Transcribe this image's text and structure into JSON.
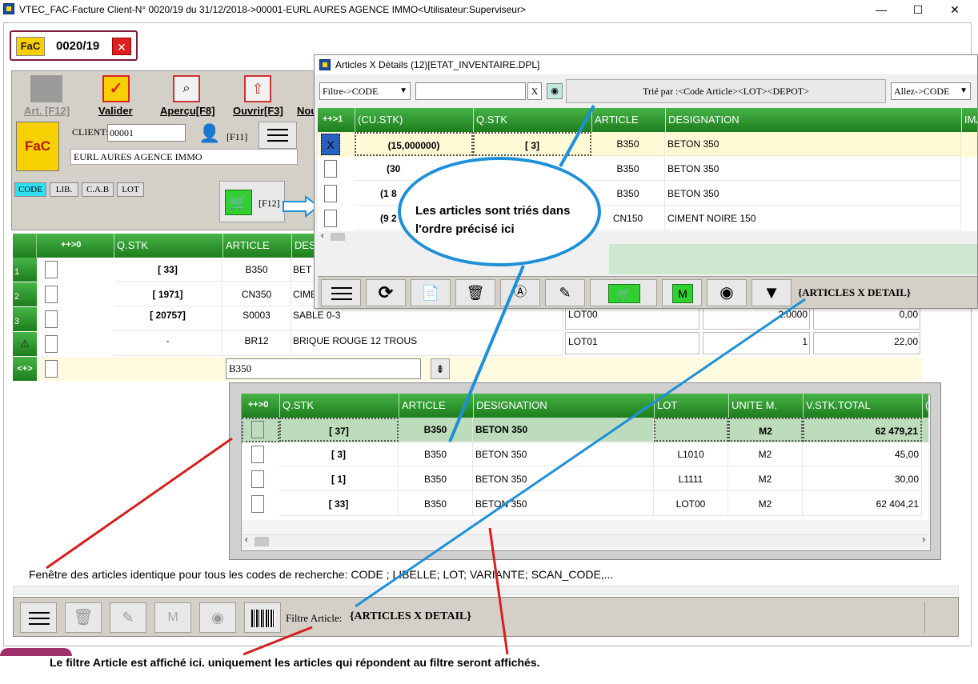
{
  "window": {
    "title": "VTEC_FAC-Facture Client-N° 0020/19 du 31/12/2018->00001-EURL AURES AGENCE IMMO<Utilisateur:Superviseur>",
    "min": "—",
    "max": "☐",
    "close": "✕"
  },
  "doc": {
    "badge": "FaC",
    "number": "0020/19",
    "close_glyph": "✕"
  },
  "toolbar": {
    "art": "Art. [F12]",
    "valider": "Valider",
    "apercu": "Aperçu[F8]",
    "ouvrir": "Ouvrir[F3]",
    "nouveau": "Nou"
  },
  "client": {
    "label": "CLIENT:",
    "code": "00001",
    "f11": "[F11]",
    "name": "EURL AURES AGENCE IMMO",
    "logo": "FaC"
  },
  "search_tabs": [
    "CODE",
    "LIB.",
    "C.A.B",
    "LOT"
  ],
  "cart": {
    "f12": "[F12]"
  },
  "main_grid": {
    "headers": [
      "++>0",
      "Q.STK",
      "ARTICLE",
      "DES"
    ],
    "rows": [
      {
        "idx": "1",
        "qstk": "[ 33]",
        "article": "B350",
        "des": "BET"
      },
      {
        "idx": "2",
        "qstk": "[ 1971]",
        "article": "CN350",
        "des": "CIME"
      },
      {
        "idx": "3",
        "qstk": "[ 20757]",
        "article": "S0003",
        "des": "SABLE 0-3",
        "lot": "LOT00",
        "qty": "2.0000",
        "price": "0,00"
      },
      {
        "idx": "⚠",
        "qstk": "-",
        "article": "BR12",
        "des": "BRIQUE ROUGE 12 TROUS",
        "lot": "LOT01",
        "qty": "1",
        "price": "22,00"
      }
    ],
    "entry": {
      "idx": "<+>",
      "value": "B350",
      "icon": "⇟"
    }
  },
  "popup": {
    "title": "Articles X Détails (12)[ETAT_INVENTAIRE.DPL]",
    "filter_select": "Filtre->CODE",
    "clear": "X",
    "sort_label": "Trié par :<Code Article><LOT><DEPOT>",
    "goto": "Allez->CODE",
    "headers": [
      "++>1",
      "(CU.STK)",
      "Q.STK",
      "ARTICLE",
      "DESIGNATION",
      "IMA"
    ],
    "rows": [
      {
        "check": "X",
        "cu": "(15,000000)",
        "qstk": "[ 3]",
        "article": "B350",
        "designation": "BETON 350"
      },
      {
        "check": "",
        "cu": "(30",
        "qstk": "",
        "article": "B350",
        "designation": "BETON 350"
      },
      {
        "check": "",
        "cu": "(1 8",
        "qstk": "",
        "article": "B350",
        "designation": "BETON 350"
      },
      {
        "check": "",
        "cu": "(9 2",
        "qstk": "",
        "article": "CN150",
        "designation": "CIMENT NOIRE 150"
      }
    ],
    "filter_text": "{ARTICLES X DETAIL}",
    "toolbar_icons": [
      "menu-icon",
      "refresh-icon",
      "preview-icon",
      "trash-icon",
      "label-icon",
      "edit-icon",
      "cart-icon",
      "m-icon",
      "eye-icon",
      "filter-icon"
    ]
  },
  "sub_grid": {
    "headers": [
      "++>0",
      "Q.STK",
      "ARTICLE",
      "DESIGNATION",
      "LOT",
      "UNITE M.",
      "V.STK.TOTAL",
      "("
    ],
    "rows": [
      {
        "qstk": "[ 37]",
        "article": "B350",
        "designation": "BETON 350",
        "lot": "",
        "unite": "M2",
        "vstk": "62 479,21"
      },
      {
        "qstk": "[ 3]",
        "article": "B350",
        "designation": "BETON 350",
        "lot": "L1010",
        "unite": "M2",
        "vstk": "45,00"
      },
      {
        "qstk": "[ 1]",
        "article": "B350",
        "designation": "BETON 350",
        "lot": "L1111",
        "unite": "M2",
        "vstk": "30,00"
      },
      {
        "qstk": "[ 33]",
        "article": "B350",
        "designation": "BETON 350",
        "lot": "LOT00",
        "unite": "M2",
        "vstk": "62 404,21"
      }
    ]
  },
  "bottom": {
    "filter_label": "Filtre Article:",
    "filter_value": "{ARTICLES X DETAIL}",
    "m": "M"
  },
  "annotations": {
    "callout": "Les articles sont triés dans l'ordre précisé ici",
    "window_note": "Fenêtre des articles identique pour tous les codes de recherche: CODE ; LIBELLE; LOT; VARIANTE; SCAN_CODE,...",
    "footer_note": "Le filtre Article est affiché ici. uniquement les articles qui répondent au filtre seront affichés."
  },
  "colors": {
    "header_green": "#2a9a2a",
    "callout_blue": "#1e90d8",
    "arrow_red": "#d42020",
    "selected_row": "#fff9d6"
  }
}
